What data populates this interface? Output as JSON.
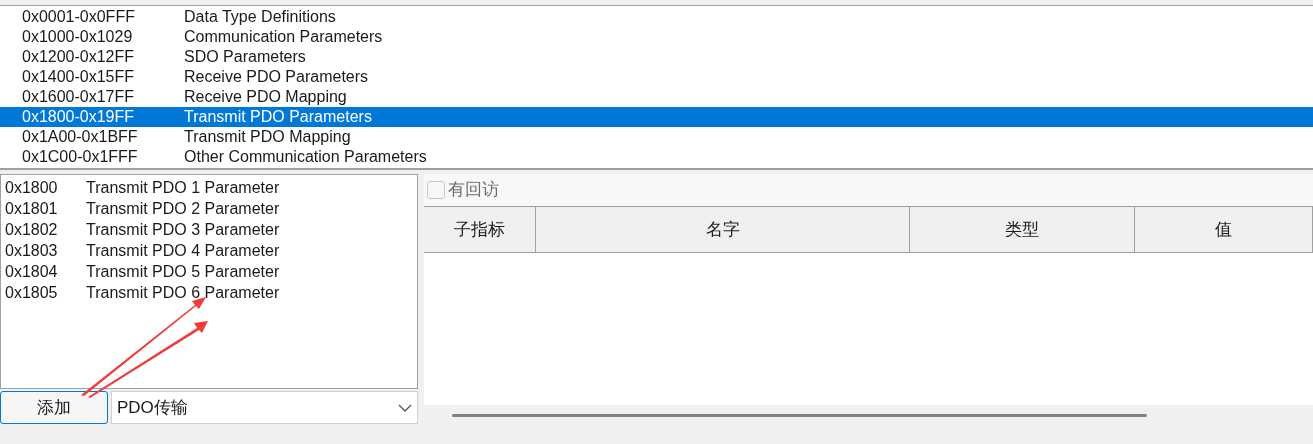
{
  "range_list": [
    {
      "range": "0x0001-0x0FFF",
      "name": "Data Type Definitions",
      "selected": false
    },
    {
      "range": "0x1000-0x1029",
      "name": "Communication Parameters",
      "selected": false
    },
    {
      "range": "0x1200-0x12FF",
      "name": "SDO Parameters",
      "selected": false
    },
    {
      "range": "0x1400-0x15FF",
      "name": "Receive PDO Parameters",
      "selected": false
    },
    {
      "range": "0x1600-0x17FF",
      "name": "Receive PDO Mapping",
      "selected": false
    },
    {
      "range": "0x1800-0x19FF",
      "name": "Transmit PDO Parameters",
      "selected": true
    },
    {
      "range": "0x1A00-0x1BFF",
      "name": "Transmit PDO Mapping",
      "selected": false
    },
    {
      "range": "0x1C00-0x1FFF",
      "name": "Other Communication Parameters",
      "selected": false
    }
  ],
  "object_list": [
    {
      "index": "0x1800",
      "name": "Transmit PDO 1 Parameter"
    },
    {
      "index": "0x1801",
      "name": "Transmit PDO 2 Parameter"
    },
    {
      "index": "0x1802",
      "name": "Transmit PDO 3 Parameter"
    },
    {
      "index": "0x1803",
      "name": "Transmit PDO 4 Parameter"
    },
    {
      "index": "0x1804",
      "name": "Transmit PDO 5 Parameter"
    },
    {
      "index": "0x1805",
      "name": "Transmit PDO 6 Parameter"
    }
  ],
  "add_button": "添加",
  "type_select": {
    "value": "PDO传输"
  },
  "callback_checkbox": {
    "label": "有回访",
    "checked": false,
    "disabled": true
  },
  "table": {
    "columns": [
      "子指标",
      "名字",
      "类型",
      "值"
    ]
  }
}
